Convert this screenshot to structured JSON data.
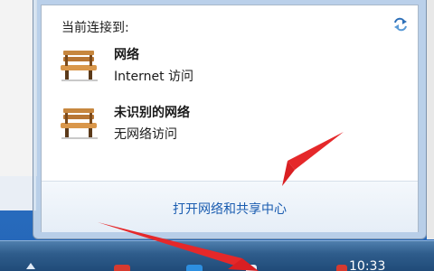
{
  "flyout": {
    "header": "当前连接到:",
    "refresh_icon": "refresh-arrows-icon",
    "networks": [
      {
        "icon": "bench-icon",
        "name": "网络",
        "status": "Internet 访问"
      },
      {
        "icon": "bench-icon",
        "name": "未识别的网络",
        "status": "无网络访问"
      }
    ],
    "footer_link": "打开网络和共享中心"
  },
  "taskbar": {
    "clock": "10:33"
  },
  "annotation": {
    "arrow_color": "#e5282a"
  },
  "colors": {
    "link": "#1a5cb0",
    "taskbar": "#2f5d8c",
    "desktop": "#2f74c7"
  }
}
